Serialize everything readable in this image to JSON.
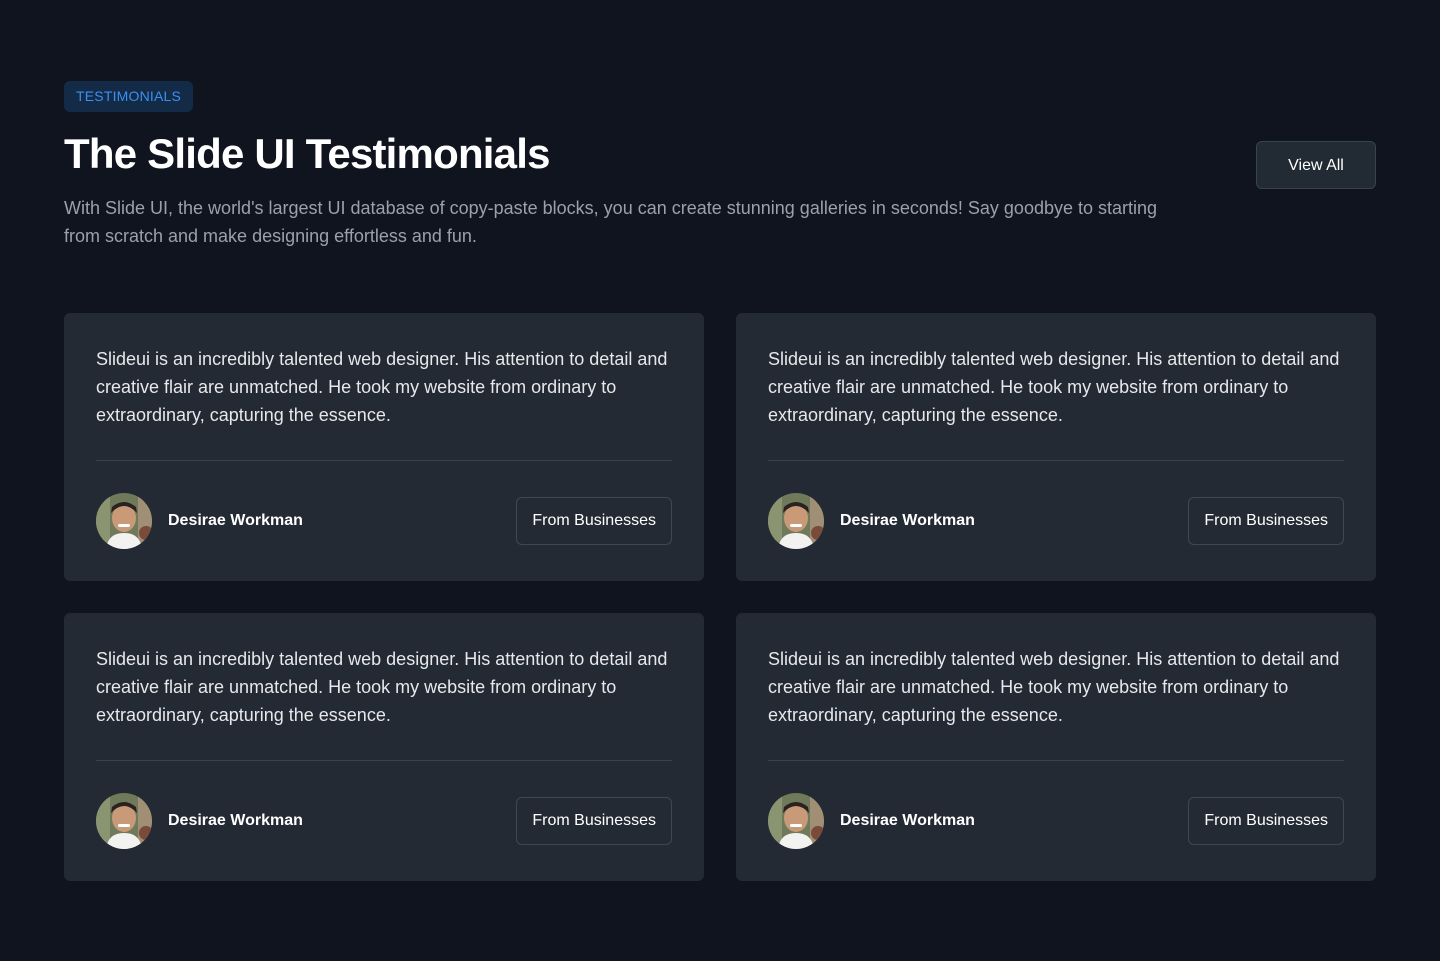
{
  "header": {
    "badge": "TESTIMONIALS",
    "title": "The Slide UI Testimonials",
    "subtitle": "With Slide UI, the world's largest UI database of copy-paste blocks, you can create stunning galleries in seconds! Say goodbye to starting from scratch and make designing effortless and fun.",
    "view_all_label": "View All"
  },
  "testimonials": [
    {
      "quote": "Slideui is an incredibly talented web designer. His attention to detail and creative flair are unmatched. He took my website from ordinary to extraordinary, capturing the essence.",
      "author": "Desirae Workman",
      "avatar_icon": "avatar-photo",
      "tag_label": "From Businesses"
    },
    {
      "quote": "Slideui is an incredibly talented web designer. His attention to detail and creative flair are unmatched. He took my website from ordinary to extraordinary, capturing the essence.",
      "author": "Desirae Workman",
      "avatar_icon": "avatar-photo",
      "tag_label": "From Businesses"
    },
    {
      "quote": "Slideui is an incredibly talented web designer. His attention to detail and creative flair are unmatched. He took my website from ordinary to extraordinary, capturing the essence.",
      "author": "Desirae Workman",
      "avatar_icon": "avatar-photo",
      "tag_label": "From Businesses"
    },
    {
      "quote": "Slideui is an incredibly talented web designer. His attention to detail and creative flair are unmatched. He took my website from ordinary to extraordinary, capturing the essence.",
      "author": "Desirae Workman",
      "avatar_icon": "avatar-photo",
      "tag_label": "From Businesses"
    }
  ],
  "colors": {
    "page_background": "#0f141e",
    "card_background": "#232a33",
    "badge_background": "#142b48",
    "badge_text": "#3b8ff0",
    "muted_text": "#9aa1ad"
  }
}
